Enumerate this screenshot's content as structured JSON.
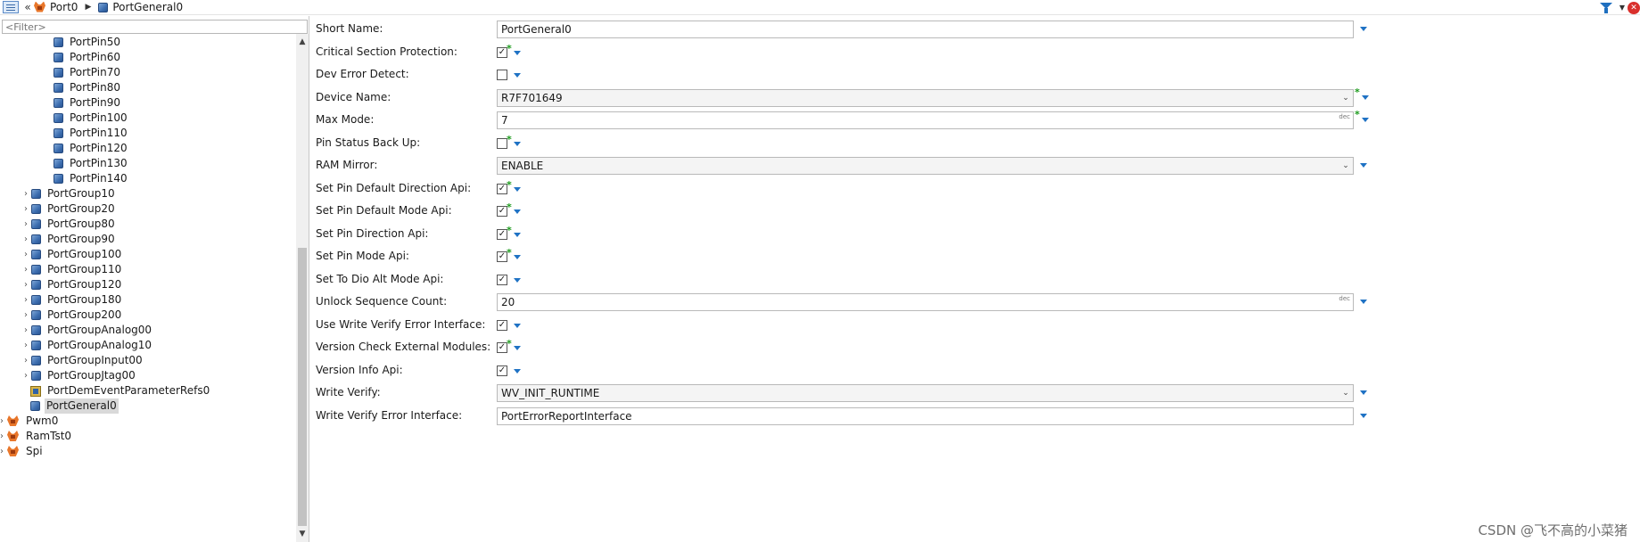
{
  "breadcrumb": {
    "back_glyph": "«",
    "items": [
      {
        "label": "Port0",
        "icon": "module-icon"
      },
      {
        "label": "PortGeneral0",
        "icon": "container-icon"
      }
    ],
    "separator": "▶"
  },
  "toolbar": {
    "filter_icon": "funnel-icon",
    "dropdown_glyph": "▼",
    "close_glyph": "✕"
  },
  "filter": {
    "placeholder": "<Filter>"
  },
  "tree": [
    {
      "label": "PortPin50",
      "type": "container",
      "level": 4,
      "expandable": false
    },
    {
      "label": "PortPin60",
      "type": "container",
      "level": 4,
      "expandable": false
    },
    {
      "label": "PortPin70",
      "type": "container",
      "level": 4,
      "expandable": false
    },
    {
      "label": "PortPin80",
      "type": "container",
      "level": 4,
      "expandable": false
    },
    {
      "label": "PortPin90",
      "type": "container",
      "level": 4,
      "expandable": false
    },
    {
      "label": "PortPin100",
      "type": "container",
      "level": 4,
      "expandable": false
    },
    {
      "label": "PortPin110",
      "type": "container",
      "level": 4,
      "expandable": false
    },
    {
      "label": "PortPin120",
      "type": "container",
      "level": 4,
      "expandable": false
    },
    {
      "label": "PortPin130",
      "type": "container",
      "level": 4,
      "expandable": false
    },
    {
      "label": "PortPin140",
      "type": "container",
      "level": 4,
      "expandable": false
    },
    {
      "label": "PortGroup10",
      "type": "container",
      "level": 3,
      "expandable": true
    },
    {
      "label": "PortGroup20",
      "type": "container",
      "level": 3,
      "expandable": true
    },
    {
      "label": "PortGroup80",
      "type": "container",
      "level": 3,
      "expandable": true
    },
    {
      "label": "PortGroup90",
      "type": "container",
      "level": 3,
      "expandable": true
    },
    {
      "label": "PortGroup100",
      "type": "container",
      "level": 3,
      "expandable": true
    },
    {
      "label": "PortGroup110",
      "type": "container",
      "level": 3,
      "expandable": true
    },
    {
      "label": "PortGroup120",
      "type": "container",
      "level": 3,
      "expandable": true
    },
    {
      "label": "PortGroup180",
      "type": "container",
      "level": 3,
      "expandable": true
    },
    {
      "label": "PortGroup200",
      "type": "container",
      "level": 3,
      "expandable": true
    },
    {
      "label": "PortGroupAnalog00",
      "type": "container",
      "level": 3,
      "expandable": true
    },
    {
      "label": "PortGroupAnalog10",
      "type": "container",
      "level": 3,
      "expandable": true
    },
    {
      "label": "PortGroupInput00",
      "type": "container",
      "level": 3,
      "expandable": true
    },
    {
      "label": "PortGroupJtag00",
      "type": "container",
      "level": 3,
      "expandable": true
    },
    {
      "label": "PortDemEventParameterRefs0",
      "type": "reference",
      "level": 2,
      "expandable": false
    },
    {
      "label": "PortGeneral0",
      "type": "container",
      "level": 2,
      "expandable": false,
      "selected": true
    },
    {
      "label": "Pwm0",
      "type": "module",
      "level": 1,
      "expandable": true
    },
    {
      "label": "RamTst0",
      "type": "module",
      "level": 1,
      "expandable": true
    },
    {
      "label": "Spi",
      "type": "module",
      "level": 1,
      "expandable": true
    }
  ],
  "scroll": {
    "up_glyph": "▲",
    "down_glyph": "▼"
  },
  "form": {
    "rows": [
      {
        "label": "Short Name:",
        "kind": "text",
        "value": "PortGeneral0"
      },
      {
        "label": "Critical Section Protection:",
        "kind": "checkbox",
        "checked": true,
        "star": true
      },
      {
        "label": "Dev Error Detect:",
        "kind": "checkbox",
        "checked": false,
        "star": false
      },
      {
        "label": "Device Name:",
        "kind": "combo",
        "value": "R7F701649",
        "star": true
      },
      {
        "label": "Max Mode:",
        "kind": "number",
        "value": "7",
        "unit": "dec",
        "star": true
      },
      {
        "label": "Pin Status Back Up:",
        "kind": "checkbox",
        "checked": false,
        "star": true
      },
      {
        "label": "RAM Mirror:",
        "kind": "combo",
        "value": "ENABLE",
        "star": false
      },
      {
        "label": "Set Pin Default Direction Api:",
        "kind": "checkbox",
        "checked": true,
        "star": true
      },
      {
        "label": "Set Pin Default Mode Api:",
        "kind": "checkbox",
        "checked": true,
        "star": true
      },
      {
        "label": "Set Pin Direction Api:",
        "kind": "checkbox",
        "checked": true,
        "star": true
      },
      {
        "label": "Set Pin Mode Api:",
        "kind": "checkbox",
        "checked": true,
        "star": true
      },
      {
        "label": "Set To Dio Alt Mode Api:",
        "kind": "checkbox",
        "checked": true,
        "star": false
      },
      {
        "label": "Unlock Sequence Count:",
        "kind": "number",
        "value": "20",
        "unit": "dec",
        "star": false
      },
      {
        "label": "Use Write Verify Error Interface:",
        "kind": "checkbox",
        "checked": true,
        "star": false
      },
      {
        "label": "Version Check External Modules:",
        "kind": "checkbox",
        "checked": true,
        "star": true
      },
      {
        "label": "Version Info Api:",
        "kind": "checkbox",
        "checked": true,
        "star": false
      },
      {
        "label": "Write Verify:",
        "kind": "combo",
        "value": "WV_INIT_RUNTIME",
        "star": false
      },
      {
        "label": "Write Verify Error Interface:",
        "kind": "text",
        "value": "PortErrorReportInterface"
      }
    ],
    "check_glyph": "✓",
    "star_glyph": "*",
    "combo_arrow_glyph": "⌄"
  },
  "watermark": "CSDN @飞不高的小菜猪",
  "colors": {
    "accent_blue": "#1f72c4",
    "star_green": "#1a9a1a",
    "selection": "#d9d9d9"
  }
}
